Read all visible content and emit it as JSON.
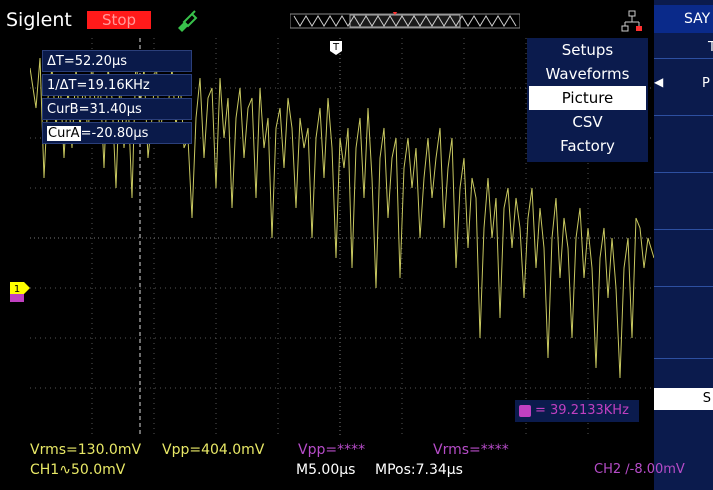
{
  "app": {
    "brand": "Siglent"
  },
  "status": {
    "run_state": "Stop"
  },
  "cursors": {
    "delta_t": "ΔT=52.20µs",
    "inv_delta_t": "1/ΔT=19.16KHz",
    "cur_b": "CurB=31.40µs",
    "cur_a_label": "CurA",
    "cur_a_value": "=-20.80µs"
  },
  "menu": {
    "items": [
      "Setups",
      "Waveforms",
      "Picture",
      "CSV",
      "Factory"
    ],
    "selected": "Picture"
  },
  "side_panel": {
    "title": "SAY",
    "partial_1": "T",
    "partial_2": "P",
    "partial_3": "S"
  },
  "markers": {
    "trigger": "T",
    "channel": "1"
  },
  "frequency": {
    "value": "= 39.2133KHz"
  },
  "measurements": {
    "vrms": "Vrms=130.0mV",
    "vpp": "Vpp=404.0mV",
    "ch2_vpp": "Vpp=****",
    "ch2_vrms": "Vrms=****"
  },
  "status_bar": {
    "ch1": "CH1∿50.0mV",
    "timebase": "M5.00µs",
    "mpos": "MPos:7.34µs",
    "ch2": "CH2 ∕-8.00mV"
  },
  "colors": {
    "ch1": "#e8e866",
    "ch2": "#b64cc8",
    "stop": "#ff1a1a",
    "panel": "#0b1b4d"
  }
}
